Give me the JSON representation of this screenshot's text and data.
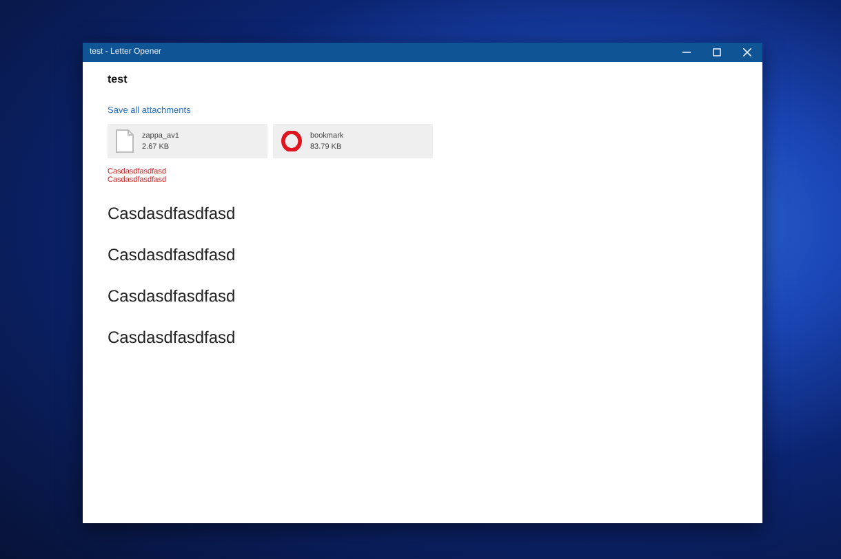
{
  "window": {
    "title": "test - Letter Opener"
  },
  "subject": "test",
  "save_all_link": "Save all attachments",
  "attachments": [
    {
      "kind": "document",
      "name": "zappa_av1",
      "size": "2.67 KB"
    },
    {
      "kind": "circle-logo",
      "name": "bookmark",
      "size": "83.79 KB"
    }
  ],
  "red_lines": [
    "Casdasdfasdfasd",
    "Casdasdfasdfasd"
  ],
  "headings": [
    "Casdasdfasdfasd",
    "Casdasdfasdfasd",
    "Casdasdfasdfasd",
    "Casdasdfasdfasd"
  ]
}
